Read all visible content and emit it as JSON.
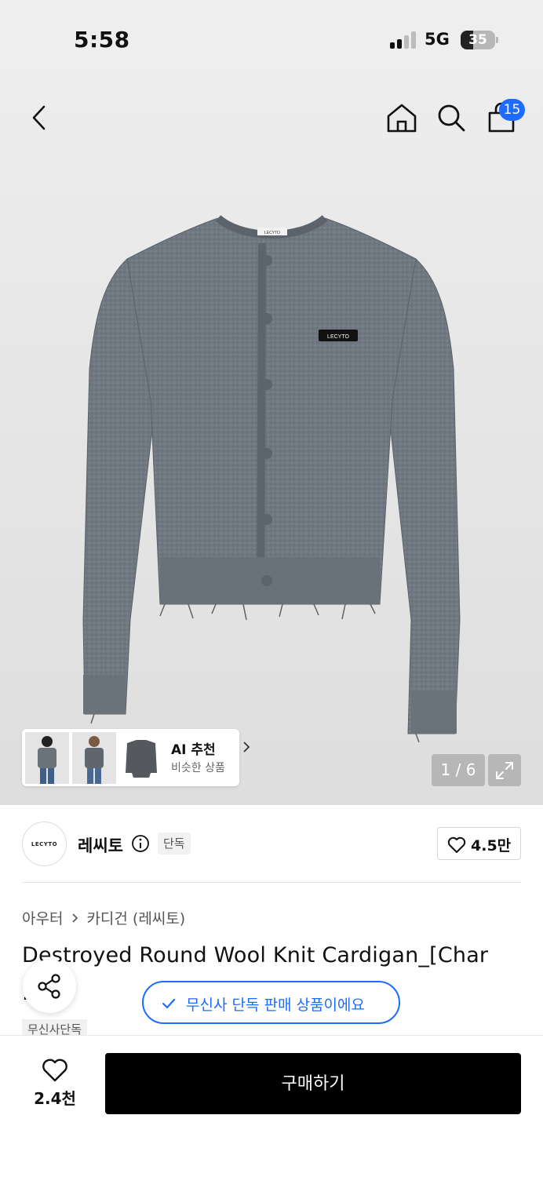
{
  "status_bar": {
    "time": "5:58",
    "network": "5G",
    "battery": "35"
  },
  "header": {
    "cart_count": "15"
  },
  "gallery": {
    "current_page": 1,
    "total_pages": 6,
    "page_indicator": "1 / 6",
    "product_label_text": "LECYTO",
    "collar_label_text": "LECYTO",
    "ai_recommend": {
      "title": "AI 추천",
      "subtitle": "비슷한 상품"
    }
  },
  "brand": {
    "logo_text": "LECYTO",
    "name": "레씨토",
    "exclusive_tag": "단독",
    "likes": "4.5만"
  },
  "breadcrumb": {
    "category": "아우터",
    "subcategory": "카디건 (레씨토)"
  },
  "product": {
    "title": "Destroyed Round Wool Knit Cardigan_[Char",
    "title_line2": "...]",
    "exclusive_tag": "무신사단독"
  },
  "toast": {
    "text": "무신사 단독 판매 상품이에요"
  },
  "bottom_bar": {
    "wish_count": "2.4천",
    "buy_label": "구매하기"
  },
  "colors": {
    "accent": "#1d6bff",
    "buy_button": "#000000"
  },
  "icons": [
    "back-icon",
    "home-icon",
    "search-icon",
    "bag-icon",
    "info-icon",
    "heart-icon",
    "share-icon",
    "check-icon",
    "expand-icon",
    "chevron-right-icon"
  ]
}
